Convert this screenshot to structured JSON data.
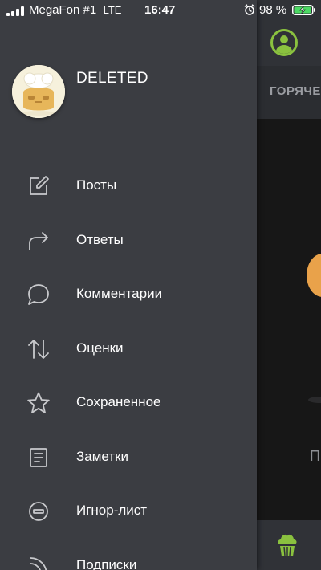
{
  "status_bar": {
    "carrier": "MegaFon #1",
    "network": "LTE",
    "time": "16:47",
    "battery": "98 %"
  },
  "background": {
    "tab_label": "ГОРЯЧЕЕ",
    "text_fragment": "П"
  },
  "profile": {
    "username": "DELETED",
    "avatar": "chef-character-avatar"
  },
  "menu": {
    "items": [
      {
        "label": "Посты",
        "icon": "edit-square-icon"
      },
      {
        "label": "Ответы",
        "icon": "reply-arrow-icon"
      },
      {
        "label": "Комментарии",
        "icon": "speech-bubble-icon"
      },
      {
        "label": "Оценки",
        "icon": "up-down-arrows-icon"
      },
      {
        "label": "Сохраненное",
        "icon": "star-icon"
      },
      {
        "label": "Заметки",
        "icon": "note-icon"
      },
      {
        "label": "Игнор-лист",
        "icon": "block-icon"
      },
      {
        "label": "Подписки",
        "icon": "rss-icon"
      }
    ]
  },
  "colors": {
    "drawer_bg": "#3b3d42",
    "accent_green": "#8ac13f",
    "icon_gray": "#c9cacd"
  }
}
